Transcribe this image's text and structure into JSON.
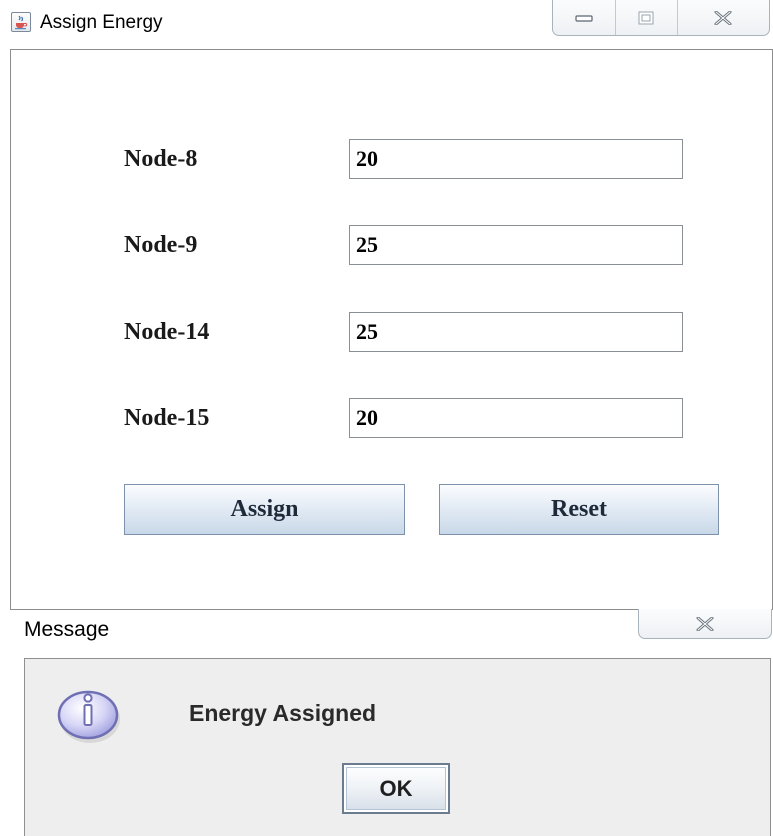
{
  "window": {
    "title": "Assign Energy",
    "icon": "java-coffee-cup-icon",
    "controls": [
      "minimize-icon",
      "maximize-icon",
      "close-icon"
    ]
  },
  "form": {
    "rows": [
      {
        "label": "Node-8",
        "value": "20"
      },
      {
        "label": "Node-9",
        "value": "25"
      },
      {
        "label": "Node-14",
        "value": "25"
      },
      {
        "label": "Node-15",
        "value": "20"
      }
    ],
    "assign_label": "Assign",
    "reset_label": "Reset"
  },
  "dialog": {
    "title": "Message",
    "icon": "info-icon",
    "message": "Energy Assigned",
    "ok_label": "OK"
  },
  "colors": {
    "button_gradient_top": "#fbfcfe",
    "button_gradient_bottom": "#c9d8e8",
    "dialog_background": "#eeeeee",
    "info_icon_fill": "#c9c8f0"
  }
}
